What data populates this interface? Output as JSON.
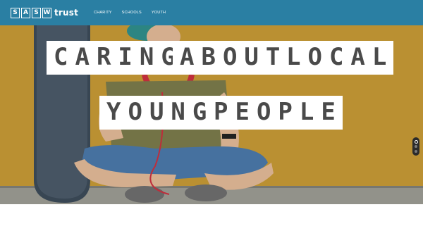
{
  "header": {
    "logo_letters": [
      "S",
      "A",
      "S",
      "W"
    ],
    "logo_word": "trust",
    "nav": [
      {
        "label": "CHARITY"
      },
      {
        "label": "SCHOOLS"
      },
      {
        "label": "YOUTH"
      }
    ],
    "background_color": "#2a7fa3"
  },
  "hero": {
    "headline_words": [
      "CARING",
      "ABOUT",
      "LOCAL",
      "YOUNG",
      "PEOPLE"
    ],
    "background_color": "#c49a36",
    "slides_total": 3,
    "active_slide": 1
  }
}
